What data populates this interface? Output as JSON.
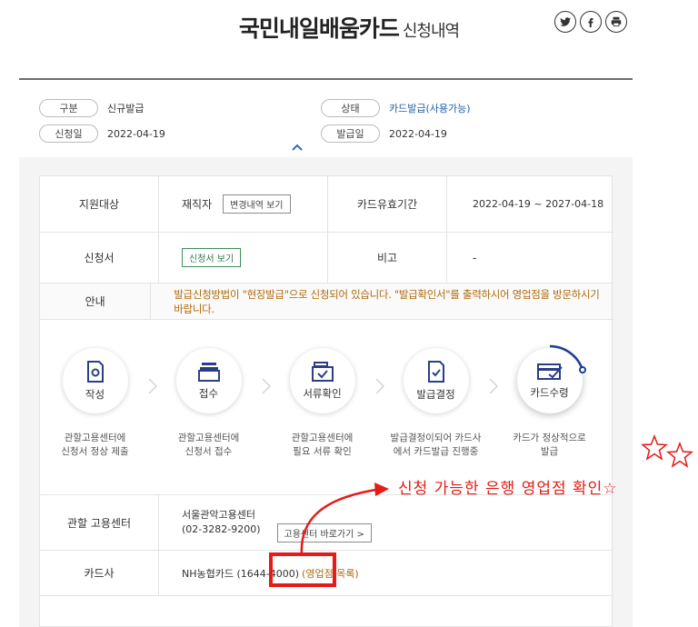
{
  "header": {
    "title": "국민내일배움카드",
    "subtitle": "신청내역"
  },
  "share": {
    "icons": [
      "twitter-icon",
      "facebook-icon",
      "print-icon"
    ]
  },
  "summary": {
    "type_label": "구분",
    "type_value": "신규발급",
    "status_label": "상태",
    "status_value": "카드발급(사용가능)",
    "apply_date_label": "신청일",
    "apply_date_value": "2022-04-19",
    "issue_date_label": "발급일",
    "issue_date_value": "2022-04-19"
  },
  "details": {
    "target_label": "지원대상",
    "target_value": "재직자",
    "history_button": "변경내역 보기",
    "validity_label": "카드유효기간",
    "validity_value": "2022-04-19 ~ 2027-04-18",
    "application_label": "신청서",
    "application_button": "신청서 보기",
    "note_label": "비고",
    "note_value": "-",
    "guide_label": "안내",
    "guide_text": "발급신청방법이 \"현장발급\"으로 신청되어 있습니다. \"발급확인서\"를 출력하시어 영업점을 방문하시기 바랍니다."
  },
  "steps": [
    {
      "name": "작성",
      "desc1": "관할고용센터에",
      "desc2": "신청서 정상 제출"
    },
    {
      "name": "접수",
      "desc1": "관할고용센터에",
      "desc2": "신청서 접수"
    },
    {
      "name": "서류확인",
      "desc1": "관할고용센터에",
      "desc2": "필요 서류 확인"
    },
    {
      "name": "발급결정",
      "desc1": "발급결정이되어 카드사",
      "desc2": "에서 카드발급 진행중"
    },
    {
      "name": "카드수령",
      "desc1": "카드가 정상적으로",
      "desc2": "발급"
    }
  ],
  "center": {
    "label": "관할 고용센터",
    "name": "서울관악고용센터",
    "phone": "(02-3282-9200)",
    "button": "고용센터 바로가기 >"
  },
  "card": {
    "label": "카드사",
    "value": "NH농협카드 (1644-4000)",
    "link": "(영업점 목록)"
  },
  "annotation": {
    "text": "신청 가능한 은행 영업점 확인☆"
  },
  "colors": {
    "accent_blue": "#1f5fa8",
    "guide_orange": "#b06a0c",
    "annotation_red": "#e41b17",
    "active_step": "#1f3f8f"
  }
}
